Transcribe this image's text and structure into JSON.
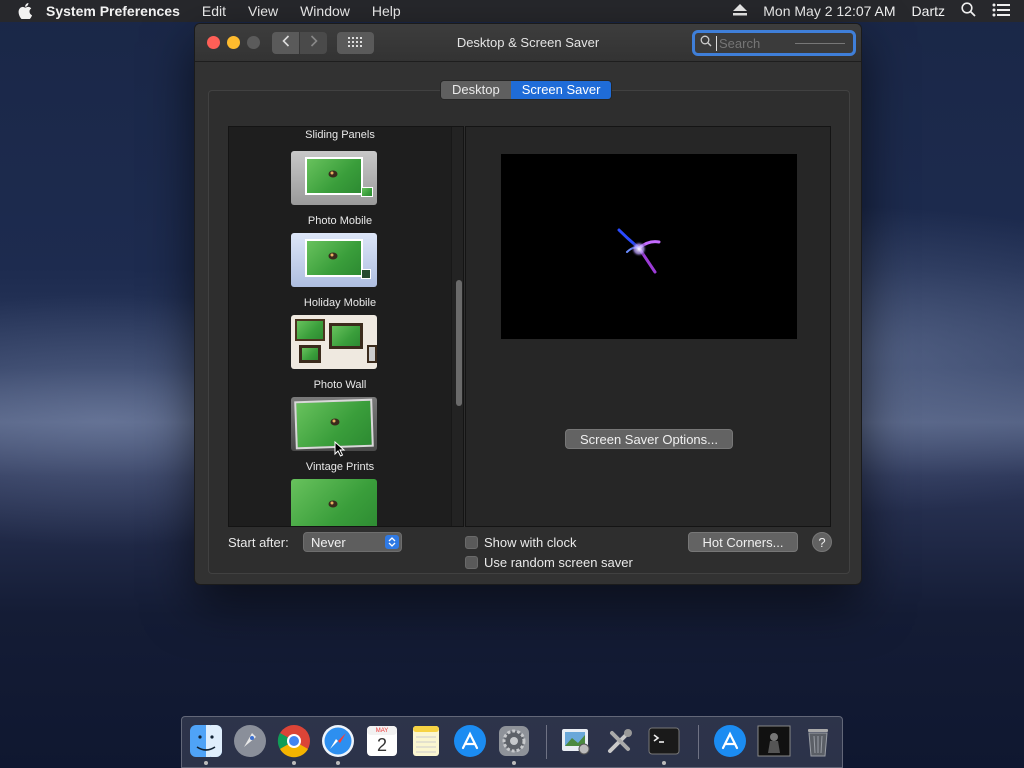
{
  "menubar": {
    "app_name": "System Preferences",
    "items": [
      "Edit",
      "View",
      "Window",
      "Help"
    ],
    "datetime": "Mon May 2  12:07 AM",
    "user": "Dartz"
  },
  "window": {
    "title": "Desktop & Screen Saver",
    "search_placeholder": "Search",
    "tabs": [
      {
        "label": "Desktop",
        "active": false
      },
      {
        "label": "Screen Saver",
        "active": true
      }
    ]
  },
  "screensavers": [
    {
      "label": "Sliding Panels"
    },
    {
      "label": "Photo Mobile"
    },
    {
      "label": "Holiday Mobile"
    },
    {
      "label": "Photo Wall"
    },
    {
      "label": "Vintage Prints"
    }
  ],
  "preview": {
    "options_button": "Screen Saver Options..."
  },
  "bottom": {
    "start_after_label": "Start after:",
    "start_after_value": "Never",
    "show_clock_label": "Show with clock",
    "show_clock_checked": false,
    "random_label": "Use random screen saver",
    "random_checked": false,
    "hot_corners_label": "Hot Corners...",
    "help_label": "?"
  },
  "calendar_icon": {
    "month": "MAY",
    "day": "2"
  },
  "accent_color": "#1f6cd8"
}
